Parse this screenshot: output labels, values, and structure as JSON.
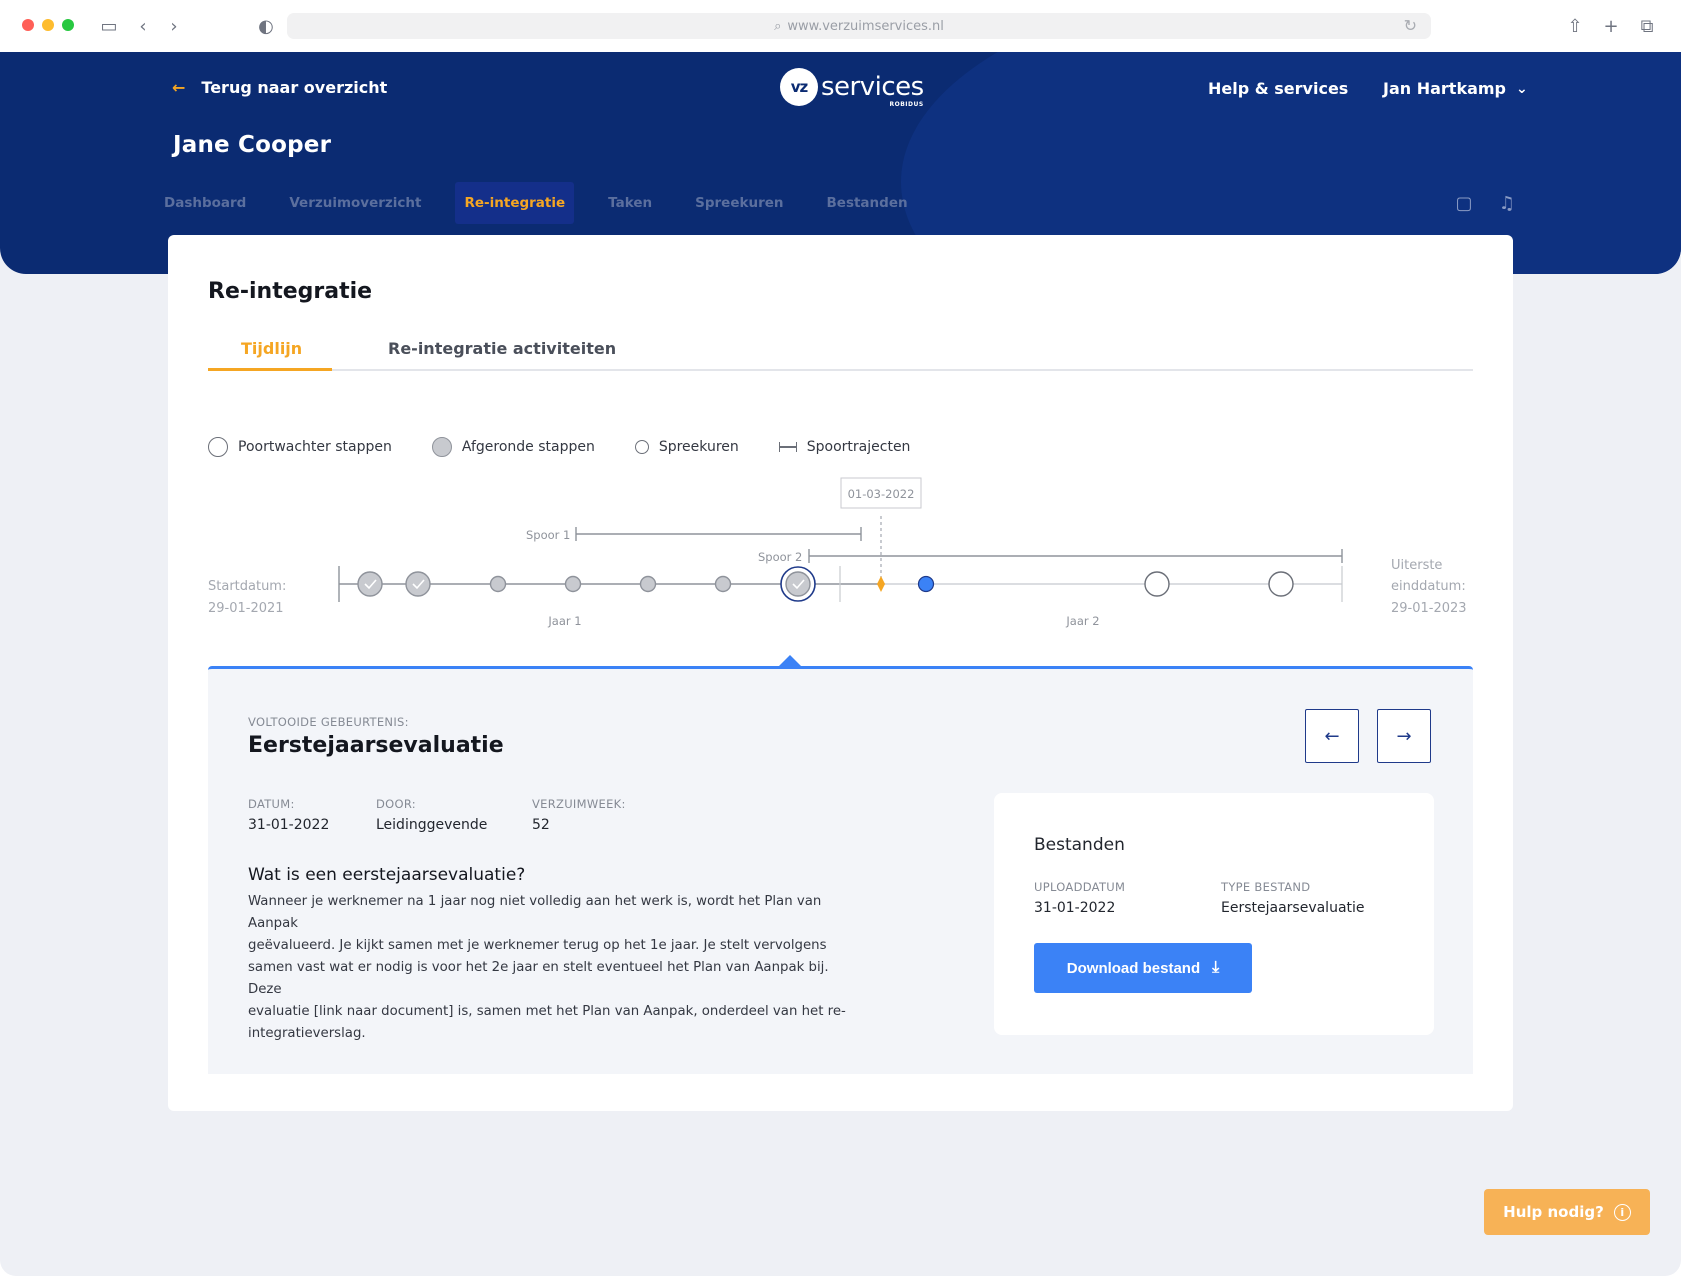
{
  "browser": {
    "url": "www.verzuimservices.nl"
  },
  "header": {
    "back_label": "Terug naar overzicht",
    "logo_mark": "vz",
    "logo_text": "services",
    "logo_sub": "ROBIDUS",
    "help_label": "Help & services",
    "user_name": "Jan Hartkamp",
    "person_name": "Jane Cooper"
  },
  "nav": {
    "items": [
      {
        "label": "Dashboard"
      },
      {
        "label": "Verzuimoverzicht"
      },
      {
        "label": "Re-integratie"
      },
      {
        "label": "Taken"
      },
      {
        "label": "Spreekuren"
      },
      {
        "label": "Bestanden"
      }
    ],
    "active": "Re-integratie"
  },
  "page": {
    "title": "Re-integratie",
    "tabs": [
      {
        "label": "Tijdlijn"
      },
      {
        "label": "Re-integratie activiteiten"
      }
    ]
  },
  "legend": {
    "items": [
      {
        "label": "Poortwachter stappen"
      },
      {
        "label": "Afgeronde stappen"
      },
      {
        "label": "Spreekuren"
      },
      {
        "label": "Spoortrajecten"
      }
    ]
  },
  "timeline": {
    "start_label": "Startdatum:",
    "start_date": "29-01-2021",
    "end_label_1": "Uiterste",
    "end_label_2": "einddatum:",
    "end_date": "29-01-2023",
    "today": "01-03-2022",
    "spoor1": "Spoor 1",
    "spoor2": "Spoor 2",
    "year1": "Jaar 1",
    "year2": "Jaar 2"
  },
  "event": {
    "kicker": "VOLTOOIDE GEBEURTENIS:",
    "title": "Eerstejaarsevaluatie",
    "date_label": "DATUM:",
    "date_value": "31-01-2022",
    "by_label": "DOOR:",
    "by_value": "Leidinggevende",
    "week_label": "VERZUIMWEEK:",
    "week_value": "52",
    "question": "Wat is een eerstejaarsevaluatie?",
    "body_lines": [
      "Wanneer je werknemer na 1 jaar nog niet volledig aan het werk is, wordt het Plan van Aanpak",
      "geëvalueerd. Je kijkt samen met je werknemer terug op het 1e jaar. Je stelt vervolgens",
      "samen vast wat er nodig is voor het 2e jaar en stelt eventueel het Plan van Aanpak bij. Deze",
      "evaluatie [link naar document] is, samen met het Plan van Aanpak, onderdeel van het re-",
      "integratieverslag."
    ]
  },
  "files": {
    "title": "Bestanden",
    "upload_label": "UPLOADDATUM",
    "upload_value": "31-01-2022",
    "type_label": "TYPE BESTAND",
    "type_value": "Eerstejaarsevaluatie",
    "download_label": "Download bestand"
  },
  "help_fab": {
    "label": "Hulp nodig?"
  },
  "colors": {
    "navy": "#0b2b72",
    "accent": "#f5a623",
    "primary": "#3b82f6",
    "background": "#eef0f5"
  }
}
